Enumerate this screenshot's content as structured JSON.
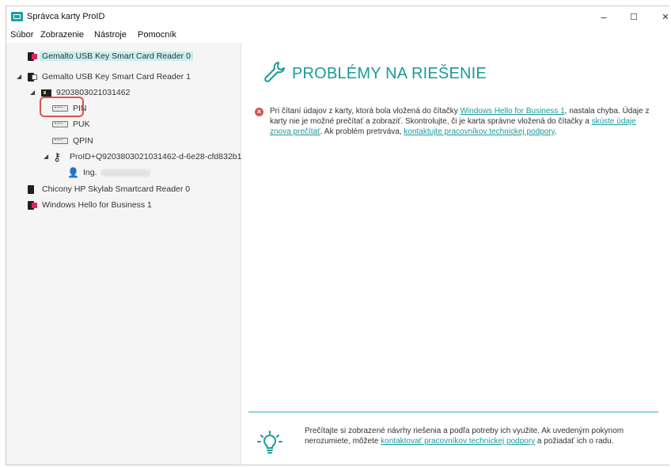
{
  "window": {
    "title": "Správca karty ProID",
    "minimize": "–",
    "maximize": "☐",
    "close": "✕"
  },
  "menu": [
    "Súbor",
    "Zobrazenie",
    "Nástroje",
    "Pomocník"
  ],
  "tree": {
    "reader1": "Gemalto USB Key Smart Card Reader 0",
    "reader2": "Gemalto USB Key Smart Card Reader 1",
    "card": "9203803021031462",
    "pin": "PIN",
    "puk": "PUK",
    "qpin": "QPIN",
    "cert": "ProID+Q9203803021031462-d-6e28-cfd832b1",
    "user": "Ing.",
    "reader3": "Chicony HP Skylab Smartcard Reader 0",
    "reader4": "Windows Hello for Business 1"
  },
  "problems": {
    "title": "PROBLÉMY NA RIEŠENIE",
    "t1": "Pri čítaní údajov z karty, ktorá bola vložená do čítačky ",
    "link1": "Windows Hello for Business 1",
    "t2": ", nastala chyba. Údaje z karty nie je možné prečítať a zobraziť. Skontrolujte, či je karta správne vložená do čítačky a ",
    "link2": "skúste údaje znova prečítať",
    "t3": ". Ak problém pretrváva, ",
    "link3": "kontaktujte pracovníkov technickej podpory",
    "t4": "."
  },
  "hint": {
    "t1": "Prečítajte si zobrazené návrhy riešenia a podľa potreby ich využite. Ak uvedeným pokynom nerozumiete, môžete ",
    "link": "kontaktovať pracovníkov technickej podpory",
    "t2": " a požiadať ich o radu."
  },
  "colors": {
    "accent": "#1a9a9a",
    "error": "#d9534f",
    "selection": "#c8efee"
  }
}
